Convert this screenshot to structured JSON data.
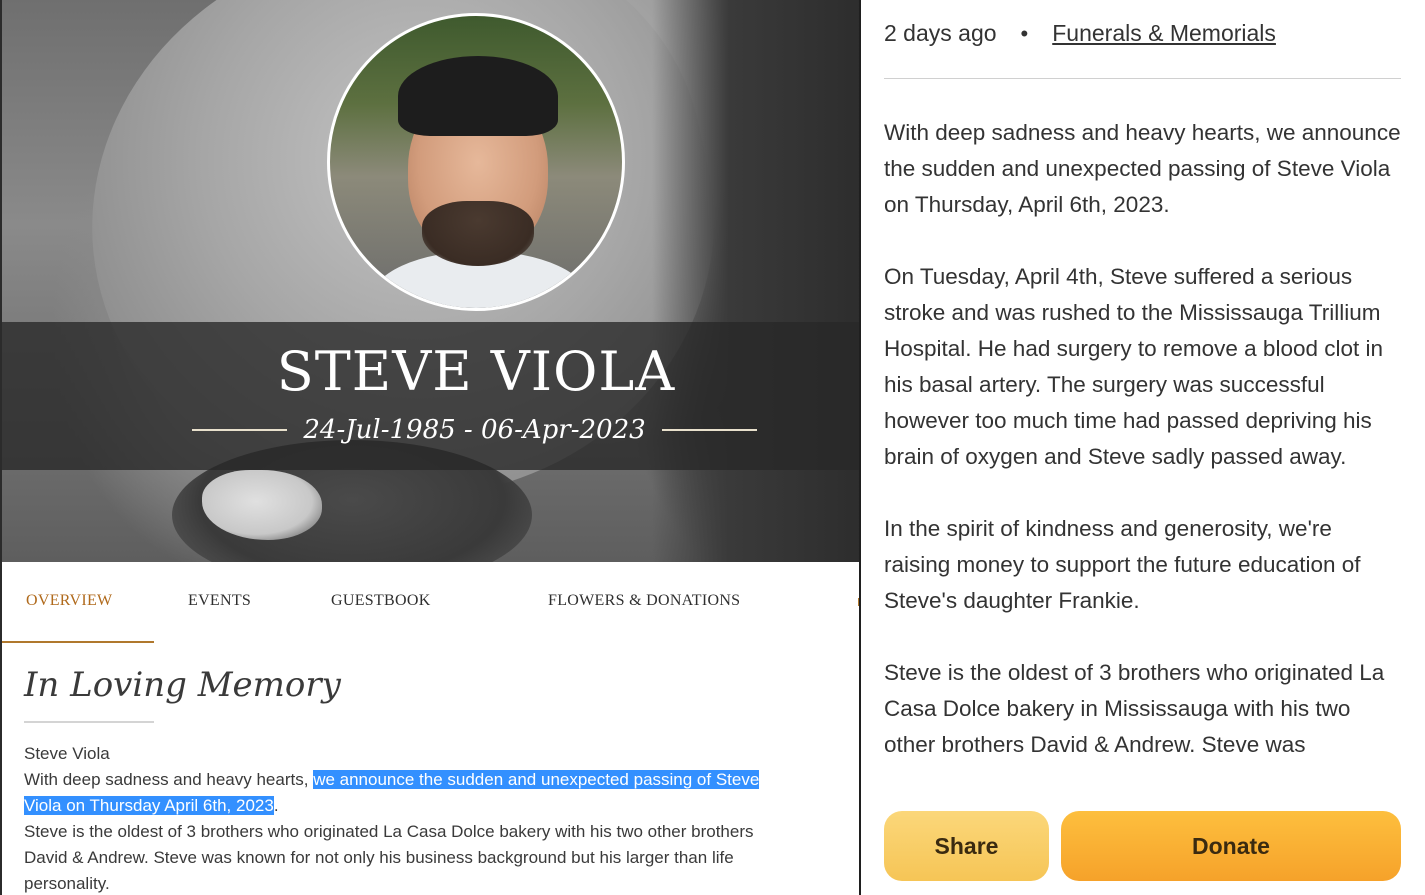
{
  "memorial": {
    "name": "STEVE VIOLA",
    "dates": "24-Jul-1985 - 06-Apr-2023"
  },
  "tabs": {
    "overview": "OVERVIEW",
    "events": "EVENTS",
    "guestbook": "GUESTBOOK",
    "flowers": "FLOWERS & DONATIONS"
  },
  "memory": {
    "title": "In Loving Memory",
    "line1": "Steve Viola",
    "line2_pre": "With deep sadness and heavy hearts, ",
    "line2_highlight": "we announce the sudden and unexpected passing of Steve Viola on Thursday April 6th, 2023",
    "line2_post": ".",
    "line3": "Steve is the oldest of 3 brothers who originated La Casa Dolce bakery with his two other brothers David & Andrew. Steve was known for not only his business background but his larger than life personality."
  },
  "fundraiser": {
    "posted": "2 days ago",
    "separator": "•",
    "category": "Funerals & Memorials",
    "paragraphs": [
      "With deep sadness and heavy hearts, we announce the sudden and unexpected passing of Steve Viola on Thursday, April 6th, 2023.",
      "On Tuesday, April 4th, Steve suffered a serious stroke and was rushed to the Mississauga Trillium Hospital. He had surgery to remove a blood clot in his basal artery. The surgery was successful however too much time had passed depriving his brain of oxygen and Steve sadly passed away.",
      "In the spirit of kindness and generosity, we're raising money to support the future education of Steve's daughter Frankie.",
      "Steve is the oldest of 3 brothers who originated La Casa Dolce bakery in Mississauga with his two other brothers David & Andrew. Steve was"
    ],
    "share_label": "Share",
    "donate_label": "Donate"
  },
  "colors": {
    "accent_tab": "#b06a1c",
    "highlight": "#3390ff",
    "share_button": "#f6c556",
    "donate_button": "#f6a22a"
  }
}
